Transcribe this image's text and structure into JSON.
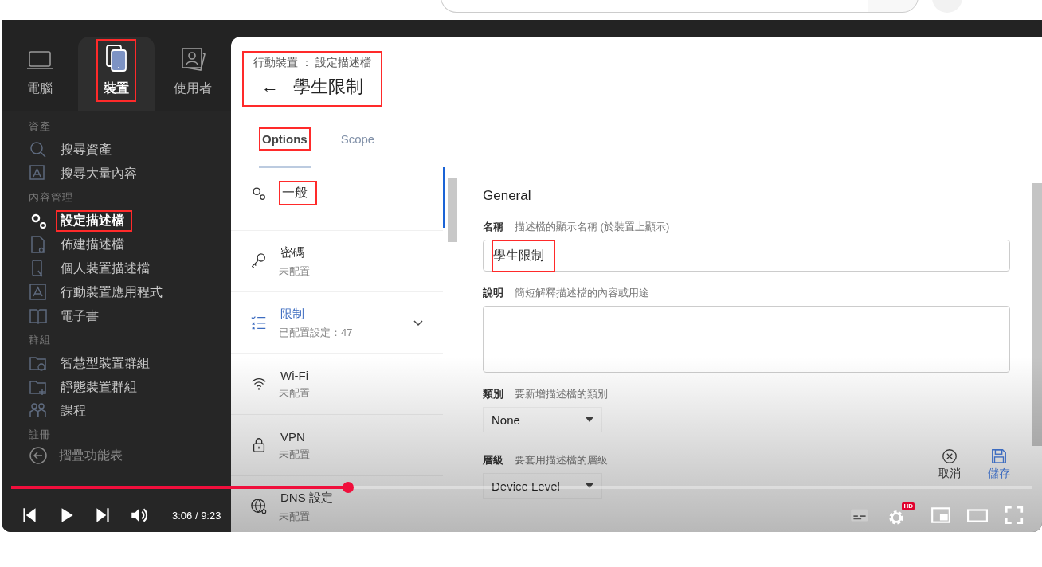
{
  "sidebar": {
    "tabs": [
      {
        "label": "電腦",
        "selected": false,
        "highlighted": false
      },
      {
        "label": "裝置",
        "selected": true,
        "highlighted": true
      },
      {
        "label": "使用者",
        "selected": false,
        "highlighted": false
      }
    ],
    "sections": [
      {
        "heading": "資產",
        "items": [
          {
            "label": "搜尋資產",
            "selected": false,
            "highlighted": false
          },
          {
            "label": "搜尋大量內容",
            "selected": false,
            "highlighted": false
          }
        ]
      },
      {
        "heading": "內容管理",
        "items": [
          {
            "label": "設定描述檔",
            "selected": true,
            "highlighted": true
          },
          {
            "label": "佈建描述檔",
            "selected": false,
            "highlighted": false
          },
          {
            "label": "個人裝置描述檔",
            "selected": false,
            "highlighted": false
          },
          {
            "label": "行動裝置應用程式",
            "selected": false,
            "highlighted": false
          },
          {
            "label": "電子書",
            "selected": false,
            "highlighted": false
          }
        ]
      },
      {
        "heading": "群組",
        "items": [
          {
            "label": "智慧型裝置群組",
            "selected": false,
            "highlighted": false
          },
          {
            "label": "靜態裝置群組",
            "selected": false,
            "highlighted": false
          },
          {
            "label": "課程",
            "selected": false,
            "highlighted": false
          }
        ]
      },
      {
        "heading": "註冊"
      }
    ],
    "collapse_label": "摺疊功能表"
  },
  "header": {
    "breadcrumb": "行動裝置 ： 設定描述檔",
    "back": "←",
    "title": "學生限制",
    "highlighted": true
  },
  "tabs": [
    {
      "label": "Options",
      "selected": true,
      "highlighted": true
    },
    {
      "label": "Scope",
      "selected": false,
      "highlighted": false
    }
  ],
  "payloads": [
    {
      "title": "一般",
      "selected": true,
      "highlighted": true,
      "configured": false,
      "expandable": false
    },
    {
      "title": "密碼",
      "subtitle": "未配置",
      "selected": false,
      "highlighted": false,
      "configured": false,
      "expandable": false
    },
    {
      "title": "限制",
      "subtitle": "已配置設定：47",
      "selected": false,
      "highlighted": false,
      "configured": true,
      "expandable": true
    },
    {
      "title": "Wi-Fi",
      "subtitle": "未配置",
      "selected": false,
      "highlighted": false,
      "configured": false,
      "expandable": false
    },
    {
      "title": "VPN",
      "subtitle": "未配置",
      "selected": false,
      "highlighted": false,
      "configured": false,
      "expandable": false
    },
    {
      "title": "DNS 設定",
      "subtitle": "未配置",
      "selected": false,
      "highlighted": false,
      "configured": false,
      "expandable": false
    }
  ],
  "form": {
    "heading": "General",
    "fields": [
      {
        "kind": "text",
        "label": "名稱",
        "hint": "描述檔的顯示名稱 (於裝置上顯示)",
        "value": "學生限制",
        "highlighted": true
      },
      {
        "kind": "textarea",
        "label": "說明",
        "hint": "簡短解釋描述檔的內容或用途"
      },
      {
        "kind": "select",
        "label": "類別",
        "hint": "要新增描述檔的類別",
        "value": "None"
      },
      {
        "kind": "select",
        "label": "層級",
        "hint": "要套用描述檔的層級",
        "value": "Device Level"
      }
    ]
  },
  "actions": [
    {
      "kind": "cancel",
      "label": "取消"
    },
    {
      "kind": "save",
      "label": "儲存"
    }
  ],
  "player": {
    "time": "3:06 / 9:23",
    "level": 0.33,
    "hd_badge": "HD"
  }
}
